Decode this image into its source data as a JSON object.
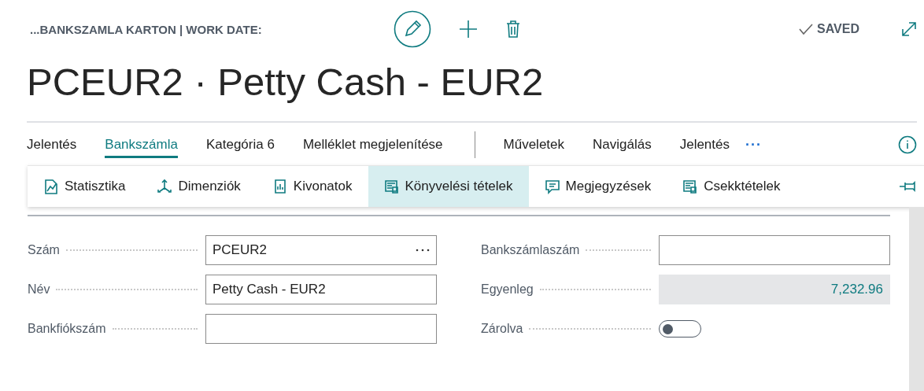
{
  "header": {
    "breadcrumb": "...BANKSZAMLA KARTON | WORK DATE:",
    "actions": [
      {
        "kind": "edit"
      },
      {
        "kind": "new"
      },
      {
        "kind": "delete"
      }
    ],
    "status": "SAVED"
  },
  "title": "PCEUR2 · Petty Cash - EUR2",
  "tabs": [
    {
      "label": "Jelentés",
      "selected": false
    },
    {
      "label": "Bankszámla",
      "selected": true
    },
    {
      "label": "Kategória 6",
      "selected": false
    },
    {
      "label": "Melléklet megjelenítése",
      "selected": false
    }
  ],
  "menus": [
    "Műveletek",
    "Navigálás",
    "Jelentés"
  ],
  "more": "···",
  "subactions": [
    {
      "label": "Statisztika",
      "kind": "chart",
      "selected": false
    },
    {
      "label": "Dimenziók",
      "kind": "dimensions",
      "selected": false
    },
    {
      "label": "Kivonatok",
      "kind": "statement",
      "selected": false
    },
    {
      "label": "Könyvelési tételek",
      "kind": "ledger",
      "selected": true
    },
    {
      "label": "Megjegyzések",
      "kind": "comment",
      "selected": false
    },
    {
      "label": "Csekktételek",
      "kind": "ledger",
      "selected": false
    }
  ],
  "fields_left": [
    {
      "label": "Szám",
      "kind": "lookup",
      "value": "PCEUR2"
    },
    {
      "label": "Név",
      "kind": "text",
      "value": "Petty Cash - EUR2"
    },
    {
      "label": "Bankfiókszám",
      "kind": "text"
    }
  ],
  "fields_right": [
    {
      "label": "Bankszámlaszám",
      "kind": "text"
    },
    {
      "label": "Egyenleg",
      "kind": "readonly",
      "value": "7,232.96"
    },
    {
      "label": "Zárolva",
      "kind": "toggle",
      "on": false
    }
  ]
}
